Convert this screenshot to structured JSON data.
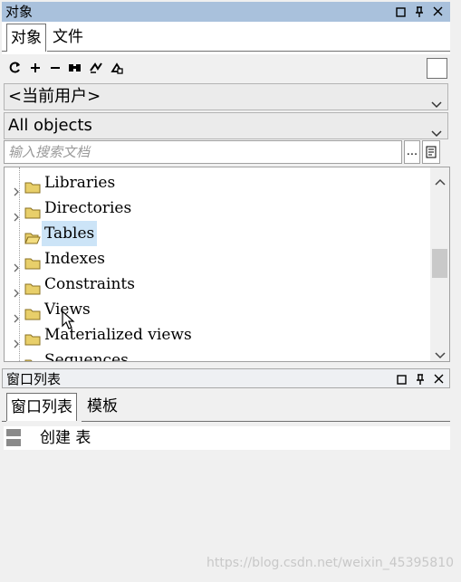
{
  "objects_panel": {
    "title": "对象",
    "tabs": [
      {
        "label": "对象",
        "active": true
      },
      {
        "label": "文件",
        "active": false
      }
    ],
    "toolbar_icons": [
      "refresh-icon",
      "add-icon",
      "remove-icon",
      "find-icon",
      "filter-icon",
      "properties-icon"
    ],
    "user_combo": {
      "value": "<当前用户>"
    },
    "type_combo": {
      "value": "All objects"
    },
    "search": {
      "placeholder": "输入搜索文档",
      "browse_label": "..."
    },
    "tree": {
      "items": [
        {
          "label": "Libraries",
          "selected": false
        },
        {
          "label": "Directories",
          "selected": false
        },
        {
          "label": "Tables",
          "selected": true
        },
        {
          "label": "Indexes",
          "selected": false
        },
        {
          "label": "Constraints",
          "selected": false
        },
        {
          "label": "Views",
          "selected": false
        },
        {
          "label": "Materialized views",
          "selected": false
        },
        {
          "label": "Sequences",
          "selected": false
        }
      ]
    }
  },
  "window_list_panel": {
    "title": "窗口列表",
    "tabs": [
      {
        "label": "窗口列表",
        "active": true
      },
      {
        "label": "模板",
        "active": false
      }
    ],
    "items": [
      {
        "label": "创建 表"
      }
    ]
  },
  "watermark": "https://blog.csdn.net/weixin_45395810",
  "colors": {
    "active_title": "#a9c1dc",
    "selection": "#cce4f7",
    "folder": "#e8cf6a"
  }
}
